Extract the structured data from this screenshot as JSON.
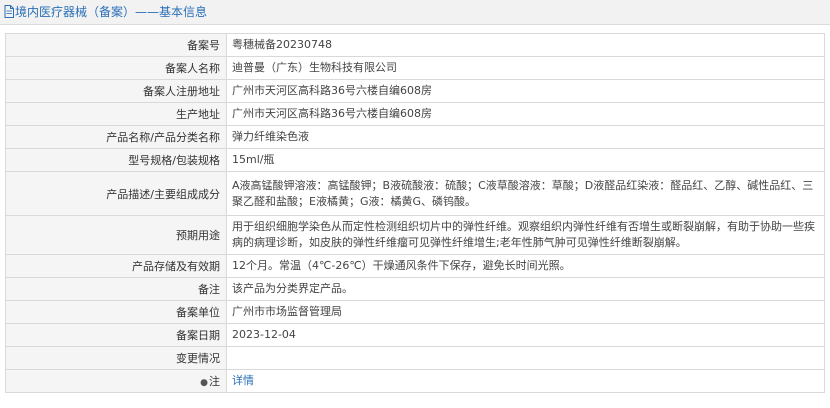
{
  "header": {
    "title": "境内医疗器械（备案）——基本信息",
    "icon": "document-icon",
    "accent_color": "#2a6fb8"
  },
  "rows": [
    {
      "label": "备案号",
      "value": "粤穗械备20230748"
    },
    {
      "label": "备案人名称",
      "value": "迪普曼（广东）生物科技有限公司"
    },
    {
      "label": "备案人注册地址",
      "value": "广州市天河区高科路36号六楼自编608房"
    },
    {
      "label": "生产地址",
      "value": "广州市天河区高科路36号六楼自编608房"
    },
    {
      "label": "产品名称/产品分类名称",
      "value": "弹力纤维染色液"
    },
    {
      "label": "型号规格/包装规格",
      "value": "15ml/瓶"
    },
    {
      "label": "产品描述/主要组成成分",
      "value": "A液高锰酸钾溶液：高锰酸钾；B液硫酸液：硫酸；C液草酸溶液：草酸；D液醛品红染液：醛品红、乙醇、碱性品红、三聚乙醛和盐酸；E液橘黄；G液：橘黄G、磷钨酸。"
    },
    {
      "label": "预期用途",
      "value": "用于组织细胞学染色从而定性检测组织切片中的弹性纤维。观察组织内弹性纤维有否增生或断裂崩解，有助于协助一些疾病的病理诊断，如皮肤的弹性纤维瘤可见弹性纤维增生;老年性肺气肿可见弹性纤维断裂崩解。"
    },
    {
      "label": "产品存储及有效期",
      "value": "12个月。常温（4℃-26℃）干燥通风条件下保存，避免长时间光照。"
    },
    {
      "label": "备注",
      "value": "该产品为分类界定产品。"
    },
    {
      "label": "备案单位",
      "value": "广州市市场监督管理局"
    },
    {
      "label": "备案日期",
      "value": "2023-12-04"
    },
    {
      "label": "变更情况",
      "value": ""
    },
    {
      "label": "注",
      "label_icon": "location-pin-icon",
      "link_text": "详情"
    }
  ]
}
